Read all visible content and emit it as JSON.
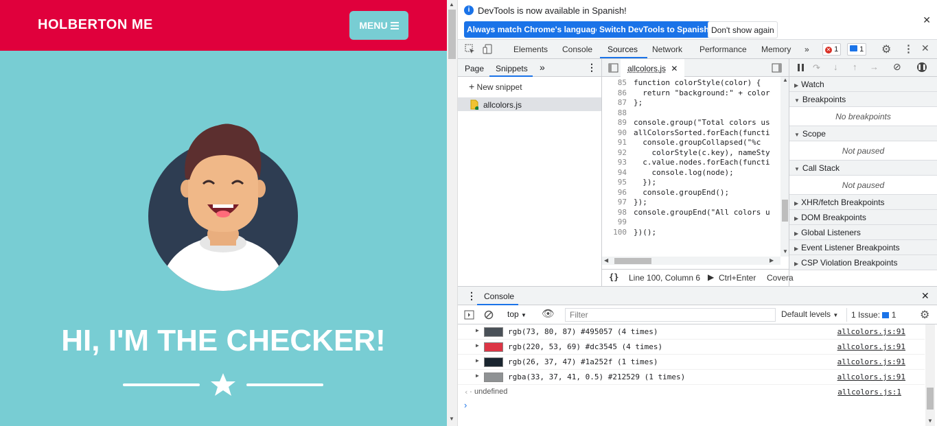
{
  "page": {
    "brand": "HOLBERTON ME",
    "menu_label": "MENU",
    "hero_heading": "HI, I'M THE CHECKER!"
  },
  "devtools": {
    "infobar": {
      "message": "DevTools is now available in Spanish!",
      "btn_match": "Always match Chrome's language",
      "btn_switch": "Switch DevTools to Spanish",
      "btn_dismiss": "Don't show again"
    },
    "tabs": [
      "Elements",
      "Console",
      "Sources",
      "Network",
      "Performance",
      "Memory"
    ],
    "error_count": "1",
    "message_count": "1",
    "navigator": {
      "tab_page": "Page",
      "tab_snippets": "Snippets",
      "new_snippet": "New snippet",
      "snippet_file": "allcolors.js"
    },
    "editor": {
      "file_tab": "allcolors.js",
      "lines": [
        {
          "n": "85",
          "code": "function colorStyle(color) {"
        },
        {
          "n": "86",
          "code": "  return \"background:\" + color"
        },
        {
          "n": "87",
          "code": "};"
        },
        {
          "n": "88",
          "code": ""
        },
        {
          "n": "89",
          "code": "console.group(\"Total colors us"
        },
        {
          "n": "90",
          "code": "allColorsSorted.forEach(functi"
        },
        {
          "n": "91",
          "code": "  console.groupCollapsed(\"%c"
        },
        {
          "n": "92",
          "code": "    colorStyle(c.key), nameSty"
        },
        {
          "n": "93",
          "code": "  c.value.nodes.forEach(functi"
        },
        {
          "n": "94",
          "code": "    console.log(node);"
        },
        {
          "n": "95",
          "code": "  });"
        },
        {
          "n": "96",
          "code": "  console.groupEnd();"
        },
        {
          "n": "97",
          "code": "});"
        },
        {
          "n": "98",
          "code": "console.groupEnd(\"All colors u"
        },
        {
          "n": "99",
          "code": ""
        },
        {
          "n": "100",
          "code": "})();"
        }
      ],
      "status_position": "Line 100, Column 6",
      "status_run": "Ctrl+Enter",
      "status_coverage": "Covera"
    },
    "debugger": {
      "watch": "Watch",
      "breakpoints": "Breakpoints",
      "no_breakpoints": "No breakpoints",
      "scope": "Scope",
      "scope_state": "Not paused",
      "call_stack": "Call Stack",
      "call_stack_state": "Not paused",
      "xhr": "XHR/fetch Breakpoints",
      "dom": "DOM Breakpoints",
      "global": "Global Listeners",
      "event": "Event Listener Breakpoints",
      "csp": "CSP Violation Breakpoints"
    },
    "console": {
      "tab": "Console",
      "context": "top",
      "filter_placeholder": "Filter",
      "levels": "Default levels",
      "issues_label": "1 Issue:",
      "issues_count": "1",
      "rows": [
        {
          "swatch": "#495057",
          "text": "rgb(73, 80, 87) #495057 (4 times)",
          "source": "allcolors.js:91"
        },
        {
          "swatch": "#dc3545",
          "text": "rgb(220, 53, 69) #dc3545 (4 times)",
          "source": "allcolors.js:91"
        },
        {
          "swatch": "#1a252f",
          "text": "rgb(26, 37, 47) #1a252f (1 times)",
          "source": "allcolors.js:91"
        },
        {
          "swatch": "#8f9294",
          "text": "rgba(33, 37, 41, 0.5) #212529 (1 times)",
          "source": "allcolors.js:91"
        }
      ],
      "result": "undefined",
      "result_source": "allcolors.js:1"
    }
  },
  "colors": {
    "brand_red": "#e0003c",
    "page_teal": "#78cdd3",
    "accent_blue": "#1a73e8"
  }
}
